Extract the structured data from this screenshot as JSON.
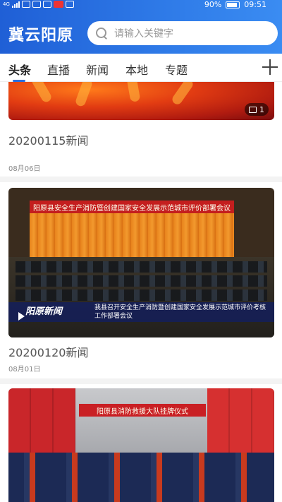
{
  "status_bar": {
    "network": "4G",
    "battery_percent": "90%",
    "time": "09:51"
  },
  "header": {
    "app_title": "冀云阳原",
    "search_placeholder": "请输入关键字"
  },
  "tabs": [
    {
      "label": "头条",
      "active": true
    },
    {
      "label": "直播",
      "active": false
    },
    {
      "label": "新闻",
      "active": false
    },
    {
      "label": "本地",
      "active": false
    },
    {
      "label": "专题",
      "active": false
    }
  ],
  "feed": [
    {
      "title": "20200115新闻",
      "date": "08月06日",
      "image_count": "1",
      "image_icon": "picture-icon"
    },
    {
      "title": "20200120新闻",
      "date": "08月01日",
      "banner_text": "阳原县安全生产消防暨创建国家安全发展示范城市评价部署会议",
      "lower_third_logo": "阳原新闻",
      "lower_third_text": "我县召开安全生产消防暨创建国家安全发展示范城市评价考核工作部署会议",
      "has_video": true
    },
    {
      "banner_text": "阳原县消防救援大队挂牌仪式"
    }
  ],
  "colors": {
    "header_gradient_start": "#1f5fd6",
    "header_gradient_end": "#3a8cf2",
    "tab_underline": "#2a6fdf"
  }
}
